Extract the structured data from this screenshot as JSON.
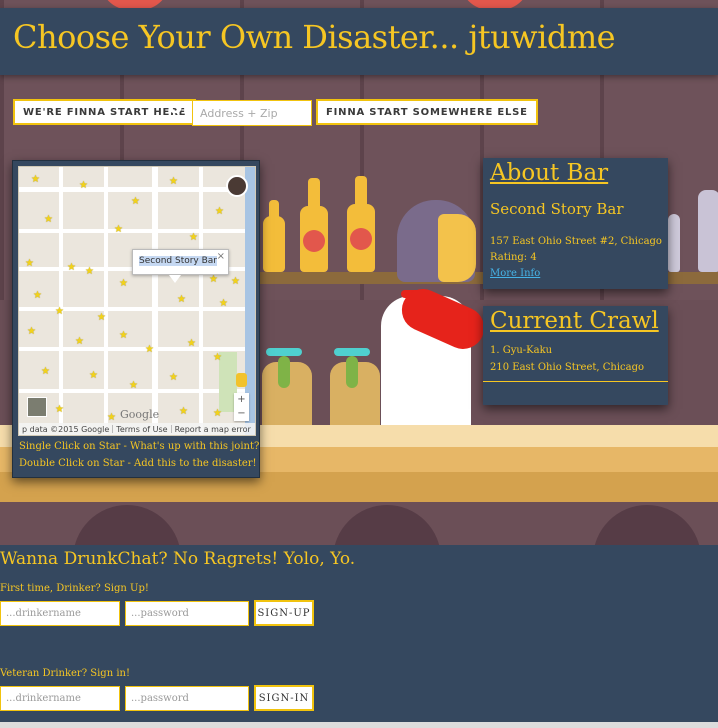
{
  "header": {
    "title": "Choose Your Own Disaster... jtuwidme"
  },
  "start": {
    "here_label": "WE'RE FINNA START HERE",
    "or_label": "or",
    "address_placeholder": "Address + Zip",
    "address_value": "",
    "elsewhere_label": "FINNA START SOMEWHERE ELSE"
  },
  "map": {
    "infowindow_text": "Second Story Bar",
    "infowindow_close": "×",
    "google_logo": "Google",
    "attribution": {
      "map_data": "p data ©2015 Google",
      "terms": "Terms of Use",
      "report": "Report a map error"
    },
    "zoom_in": "+",
    "zoom_out": "−",
    "help_single": "Single Click on Star - What's up with this joint?",
    "help_double": "Double Click on Star - Add this to the disaster!"
  },
  "about_bar": {
    "heading": "About Bar",
    "name": "Second Story Bar",
    "address": "157 East Ohio Street #2, Chicago",
    "rating": "Rating: 4",
    "more_info": "More Info"
  },
  "current_crawl": {
    "heading": "Current Crawl",
    "items": [
      {
        "name": "1. Gyu-Kaku",
        "address": "210 East Ohio Street, Chicago"
      }
    ]
  },
  "chat": {
    "heading": "Wanna DrunkChat? No Ragrets! Yolo, Yo.",
    "signup": {
      "label": "First time, Drinker? Sign Up!",
      "name_placeholder": "...drinkername",
      "password_placeholder": "...password",
      "button": "SIGN-UP"
    },
    "signin": {
      "label": "Veteran Drinker? Sign in!",
      "name_placeholder": "...drinkername",
      "password_placeholder": "...password",
      "button": "SIGN-IN"
    }
  },
  "colors": {
    "navy": "#35485f",
    "accent_yellow": "#f6c623",
    "border_yellow": "#f1c30e",
    "link_blue": "#45b3e7"
  },
  "icons": {
    "map_marker": "star-icon",
    "close": "close-icon",
    "user_avatar": "avatar-icon",
    "street_view": "pegman-icon"
  }
}
